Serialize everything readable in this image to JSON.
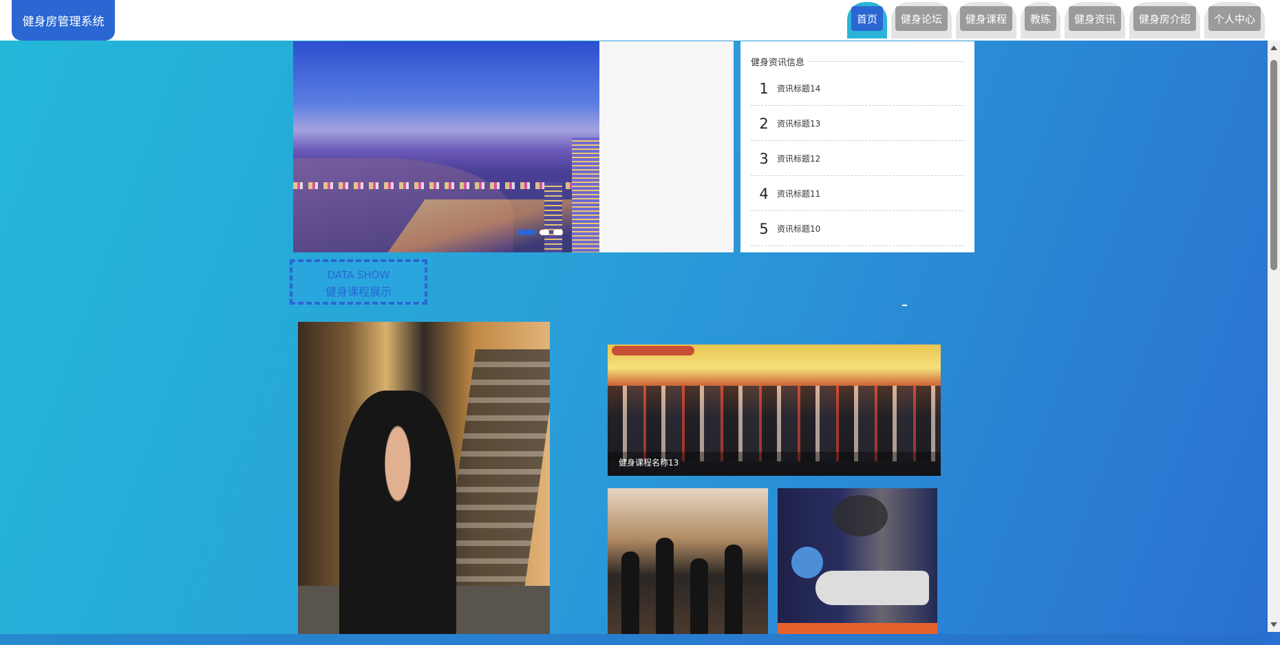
{
  "header": {
    "logo": "健身房管理系统",
    "nav": [
      {
        "label": "首页",
        "active": true
      },
      {
        "label": "健身论坛",
        "active": false
      },
      {
        "label": "健身课程",
        "active": false
      },
      {
        "label": "教练",
        "active": false
      },
      {
        "label": "健身资讯",
        "active": false
      },
      {
        "label": "健身房介绍",
        "active": false
      },
      {
        "label": "个人中心",
        "active": false
      }
    ]
  },
  "banner": {
    "image": "city-night-skyline",
    "slide_count": 3,
    "active_slide": 1
  },
  "news": {
    "title": "健身资讯信息",
    "items": [
      {
        "num": "1",
        "text": "资讯标题14"
      },
      {
        "num": "2",
        "text": "资讯标题13"
      },
      {
        "num": "3",
        "text": "资讯标题12"
      },
      {
        "num": "4",
        "text": "资讯标题11"
      },
      {
        "num": "5",
        "text": "资讯标题10"
      }
    ]
  },
  "section": {
    "en": "DATA SHOW",
    "cn": "健身课程展示"
  },
  "courses": {
    "featured_caption": "健身课程名称13"
  },
  "colors": {
    "accent": "#2a67d3",
    "active_tab_ring": "#2bb3d8",
    "bg_start": "#23b8d8",
    "bg_end": "#2a6fd0"
  }
}
